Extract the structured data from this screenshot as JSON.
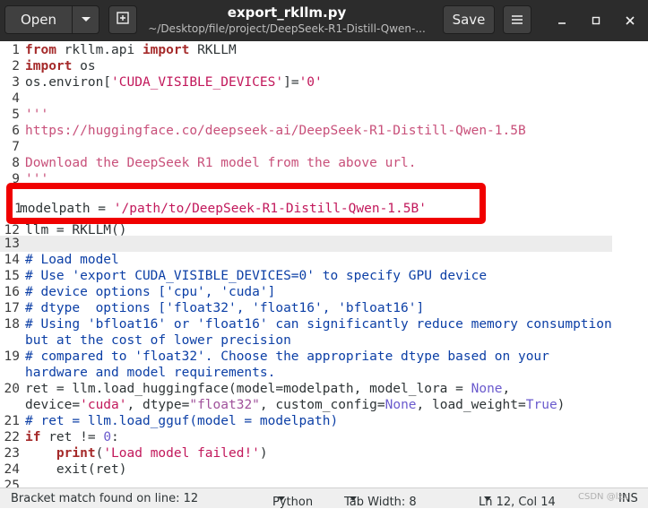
{
  "header": {
    "open_label": "Open",
    "title": "export_rkllm.py",
    "subtitle": "~/Desktop/file/project/DeepSeek-R1-Distill-Qwen-...",
    "save_label": "Save"
  },
  "editor": {
    "lines": [
      {
        "num": "1"
      },
      {
        "num": "2"
      },
      {
        "num": "3"
      },
      {
        "num": "4"
      },
      {
        "num": "5"
      },
      {
        "num": "6"
      },
      {
        "num": "7"
      },
      {
        "num": "8"
      },
      {
        "num": "9"
      },
      {
        "num": "1"
      },
      {
        "num": "12"
      },
      {
        "num": "13"
      },
      {
        "num": "14"
      },
      {
        "num": "15"
      },
      {
        "num": "16"
      },
      {
        "num": "17"
      },
      {
        "num": "18"
      },
      {
        "num": ""
      },
      {
        "num": "19"
      },
      {
        "num": ""
      },
      {
        "num": "20"
      },
      {
        "num": ""
      },
      {
        "num": "21"
      },
      {
        "num": "22"
      },
      {
        "num": "23"
      },
      {
        "num": "24"
      },
      {
        "num": "25"
      }
    ],
    "t": {
      "l1_a": "from",
      "l1_b": " rkllm.api ",
      "l1_c": "import",
      "l1_d": " RKLLM",
      "l2_a": "import",
      "l2_b": " os",
      "l3_a": "os.environ[",
      "l3_b": "'CUDA_VISIBLE_DEVICES'",
      "l3_c": "]=",
      "l3_d": "'0'",
      "l4": "'''",
      "l6": "https://huggingface.co/deepseek-ai/DeepSeek-R1-Distill-Qwen-1.5B",
      "l8": "Download the DeepSeek R1 model from the above url.",
      "l9": "'''",
      "l11_a": "modelpath = ",
      "l11_b": "'/path/to/DeepSeek-R1-Distill-Qwen-1.5B'",
      "l12": "llm = RKLLM()",
      "l14": "# Load model",
      "l15": "# Use 'export CUDA_VISIBLE_DEVICES=0' to specify GPU device",
      "l16": "# device options ['cpu', 'cuda']",
      "l17": "# dtype  options ['float32', 'float16', 'bfloat16']",
      "l18a": "# Using 'bfloat16' or 'float16' can significantly reduce memory consumption",
      "l18b": "but at the cost of lower precision",
      "l19a": "# compared to 'float32'. Choose the appropriate dtype based on your",
      "l19b": "hardware and model requirements.",
      "l20a_1": "ret = llm.load_huggingface(model=modelpath, model_lora = ",
      "l20a_2": "None",
      "l20a_3": ",",
      "l20b_1": "device=",
      "l20b_2": "'cuda'",
      "l20b_3": ", dtype=",
      "l20b_4": "\"float32\"",
      "l20b_5": ", custom_config=",
      "l20b_6": "None",
      "l20b_7": ", load_weight=",
      "l20b_8": "True",
      "l20b_9": ")",
      "l21": "# ret = llm.load_gguf(model = modelpath)",
      "l22_a": "if",
      "l22_b": " ret != ",
      "l22_c": "0",
      "l22_d": ":",
      "l23_a": "    ",
      "l23_b": "print",
      "l23_c": "(",
      "l23_d": "'Load model failed!'",
      "l23_e": ")",
      "l24": "    exit(ret)"
    }
  },
  "status": {
    "message": "Bracket match found on line: 12",
    "language": "Python",
    "tab_width": "Tab Width: 8",
    "position": "Ln 12, Col 14",
    "mode": "INS",
    "watermark": "CSDN @lzx"
  }
}
